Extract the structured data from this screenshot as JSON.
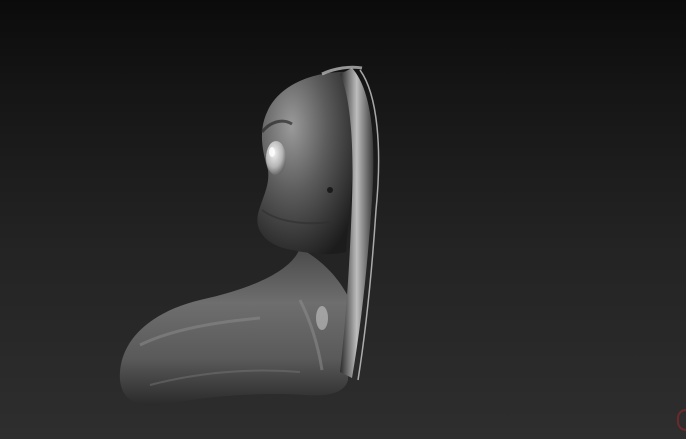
{
  "viewport": {
    "background_top": "#0b0b0b",
    "background_bottom": "#2e2e2e",
    "model_label": "",
    "corner_marker_color": "#7a2a2a"
  }
}
